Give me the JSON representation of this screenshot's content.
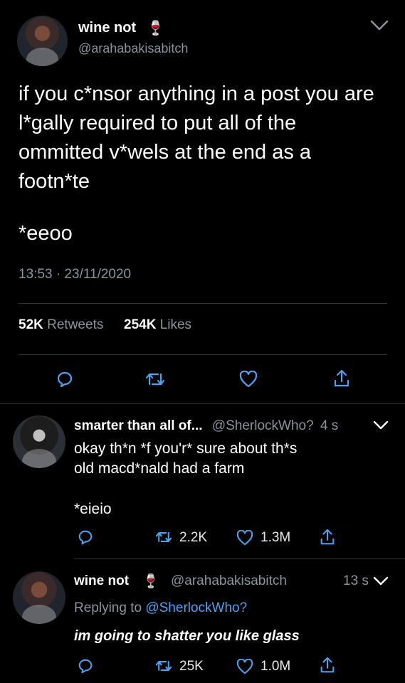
{
  "main_tweet": {
    "display_name": "wine not",
    "emoji": "🍷",
    "handle": "@arahabakisabitch",
    "text": "if you c*nsor anything in a post you are l*gally required to put all of the ommitted v*wels at the end as a footn*te",
    "footnote": "*eeoo",
    "timestamp": "13:53 · 23/11/2020",
    "retweets_count": "52K",
    "retweets_label": "Retweets",
    "likes_count": "254K",
    "likes_label": "Likes"
  },
  "replies": [
    {
      "display_name": "smarter than all of...",
      "handle": "@SherlockWho?",
      "age": "4 s",
      "line1": "okay th*n *f you'r* sure about th*s",
      "line2": "old macd*nald had a farm",
      "footnote": "*eieio",
      "retweets": "2.2K",
      "likes": "1.3M"
    },
    {
      "display_name": "wine not",
      "emoji": "🍷",
      "handle": "@arahabakisabitch",
      "age": "13 s",
      "replying_prefix": "Replying to",
      "replying_handle": "@SherlockWho?",
      "text": "im going to shatter you like glass",
      "retweets": "25K",
      "likes": "1.0M"
    }
  ],
  "icons": [
    "chevron-down-icon",
    "reply-icon",
    "retweet-icon",
    "like-icon",
    "share-icon",
    "wine-glass-icon"
  ]
}
